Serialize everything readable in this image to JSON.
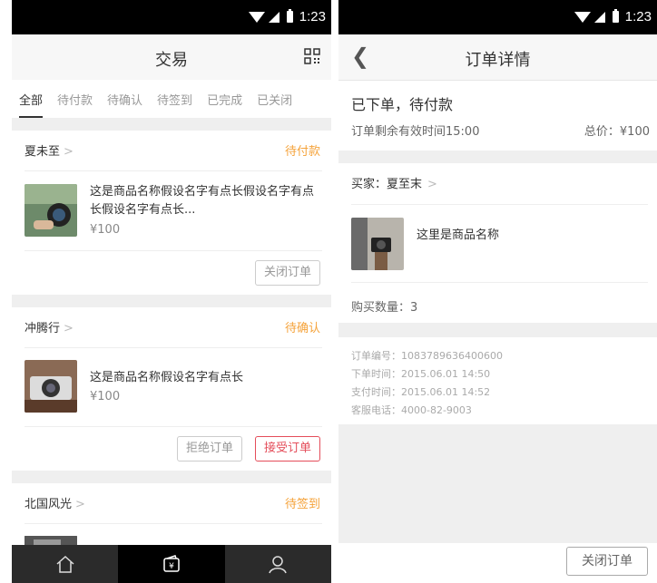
{
  "status_bar": {
    "time": "1:23"
  },
  "left": {
    "title": "交易",
    "tabs": [
      "全部",
      "待付款",
      "待确认",
      "待签到",
      "已完成",
      "已关闭"
    ],
    "orders": [
      {
        "shop": "夏未至",
        "status": "待付款",
        "name": "这是商品名称假设名字有点长假设名字有点长假设名字有点长...",
        "price": "¥100",
        "buttons": [
          "关闭订单"
        ]
      },
      {
        "shop": "冲腾行",
        "status": "待确认",
        "name": "这是商品名称假设名字有点长",
        "price": "¥100",
        "buttons": [
          "拒绝订单",
          "接受订单"
        ]
      },
      {
        "shop": "北国风光",
        "status": "待签到"
      }
    ],
    "colors": {
      "pending_status": "#f5a33b",
      "accent_red": "#e44d5a",
      "tabbar_bg": "#2b2b2b"
    },
    "tabbar": [
      "home-icon",
      "wallet-icon",
      "profile-icon"
    ]
  },
  "right": {
    "title": "订单详情",
    "state": "已下单，待付款",
    "timer": "订单剩余有效时间15:00",
    "total": "总价：¥100",
    "buyer": "买家：夏至末",
    "product_name": "这里是商品名称",
    "quantity": "购买数量：3",
    "info": [
      "订单编号：1083789636400600",
      "下单时间：2015.06.01  14:50",
      "支付时间：2015.06.01  14:52",
      "客服电话：4000-82-9003"
    ],
    "close_button": "关闭订单"
  }
}
